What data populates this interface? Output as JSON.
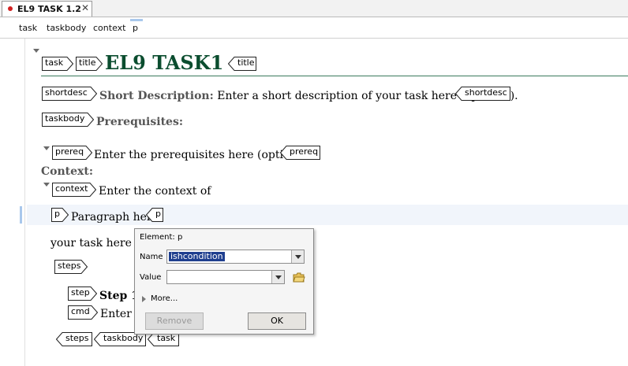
{
  "tab": {
    "title": "EL9 TASK 1.2",
    "close_glyph": "✕"
  },
  "breadcrumb": [
    "task",
    "taskbody",
    "context",
    "p"
  ],
  "document": {
    "title_text": "EL9 TASK1",
    "shortdesc_label": "Short Description:",
    "shortdesc_text": "Enter a short description of your task here (optional).",
    "prereq_heading": "Prerequisites:",
    "prereq_text": "Enter the prerequisites here (optional).",
    "context_heading": "Context:",
    "context_text": "Enter the context of",
    "paragraph_text": "Paragraph here",
    "context_tail": "your task here (op",
    "step_label": "Step 1",
    "cmd_text": "Enter y"
  },
  "tags": {
    "task": "task",
    "title": "title",
    "shortdesc": "shortdesc",
    "taskbody": "taskbody",
    "prereq": "prereq",
    "context": "context",
    "p": "p",
    "steps": "steps",
    "step": "step",
    "cmd": "cmd"
  },
  "popup": {
    "header": "Element: p",
    "name_label": "Name",
    "name_value": "ishcondition",
    "value_label": "Value",
    "value_value": "",
    "more_label": "More...",
    "remove_button": "Remove",
    "ok_button": "OK"
  },
  "colors": {
    "title": "#0b4d2f",
    "tab_dot": "#d22020",
    "selection": "#1f3f8f",
    "current_line": "#a9c8ec"
  }
}
